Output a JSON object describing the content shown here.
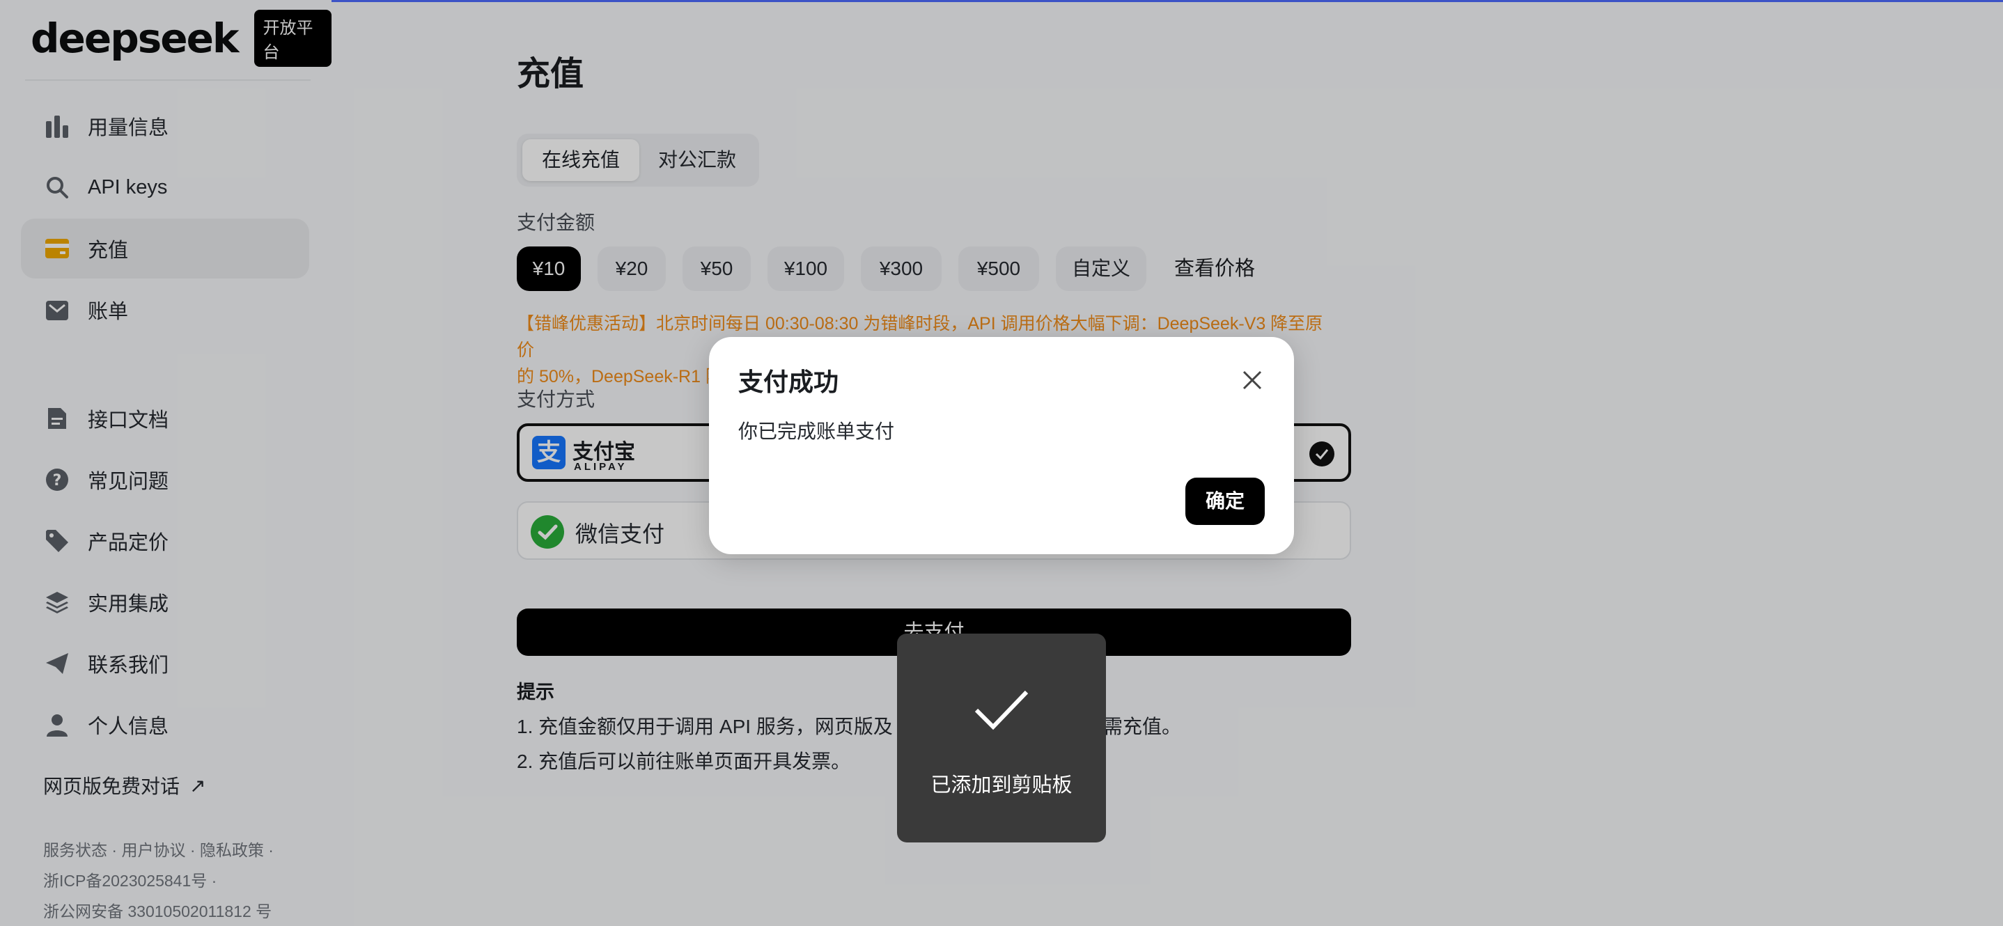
{
  "brand": {
    "logo": "deepseek",
    "badge": "开放平台"
  },
  "sidebar": {
    "items": [
      {
        "label": "用量信息",
        "icon": "bar-chart-icon"
      },
      {
        "label": "API keys",
        "icon": "search-key-icon"
      },
      {
        "label": "充值",
        "icon": "wallet-icon",
        "active": true
      },
      {
        "label": "账单",
        "icon": "bill-icon"
      },
      {
        "label": "接口文档",
        "icon": "doc-icon"
      },
      {
        "label": "常见问题",
        "icon": "question-icon"
      },
      {
        "label": "产品定价",
        "icon": "tag-icon"
      },
      {
        "label": "实用集成",
        "icon": "layers-icon"
      },
      {
        "label": "联系我们",
        "icon": "send-icon"
      },
      {
        "label": "个人信息",
        "icon": "user-icon"
      }
    ],
    "web_chat": "网页版免费对话",
    "footer": [
      "服务状态 · 用户协议 · 隐私政策 ·",
      "浙ICP备2023025841号 ·",
      "浙公网安备 33010502011812 号"
    ]
  },
  "main": {
    "title": "充值",
    "tabs": [
      "在线充值",
      "对公汇款"
    ],
    "amount_label": "支付金额",
    "amounts": [
      "¥10",
      "¥20",
      "¥50",
      "¥100",
      "¥300",
      "¥500",
      "自定义"
    ],
    "view_price": "查看价格",
    "promo_line1": "【错峰优惠活动】北京时间每日 00:30-08:30 为错峰时段，API 调用价格大幅下调：DeepSeek-V3 降至原价",
    "promo_line2": "的 50%，DeepSeek-R1 降",
    "method_label": "支付方式",
    "alipay": {
      "name": "支付宝",
      "sub": "ALIPAY",
      "logo_char": "支"
    },
    "wechat": {
      "name": "微信支付"
    },
    "go_pay": "去支付",
    "tips_title": "提示",
    "tip1": "1. 充值金额仅用于调用 API 服务，网页版及",
    "tip1_tail": "需充值。",
    "tip2": "2. 充值后可以前往账单页面开具发票。"
  },
  "modal": {
    "title": "支付成功",
    "body": "你已完成账单支付",
    "ok": "确定"
  },
  "toast": {
    "text": "已添加到剪贴板"
  },
  "colors": {
    "accent": "#4d6bfe",
    "promo": "#f08c1a",
    "active_icon": "#f0a800"
  }
}
